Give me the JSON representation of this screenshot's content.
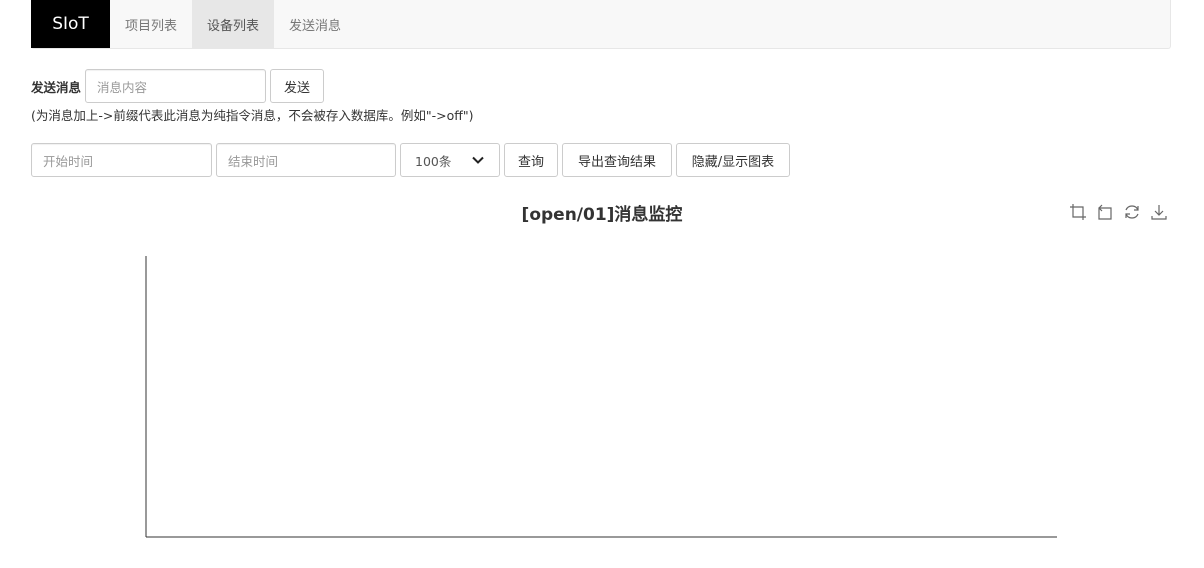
{
  "nav": {
    "brand": "SIoT",
    "items": [
      {
        "label": "项目列表"
      },
      {
        "label": "设备列表"
      },
      {
        "label": "发送消息"
      }
    ]
  },
  "send": {
    "label": "发送消息",
    "placeholder": "消息内容",
    "button": "发送",
    "hint": "(为消息加上->前缀代表此消息为纯指令消息，不会被存入数据库。例如\"->off\")"
  },
  "query": {
    "start_placeholder": "开始时间",
    "end_placeholder": "结束时间",
    "limit_value": "100条",
    "query_button": "查询",
    "export_button": "导出查询结果",
    "toggle_chart_button": "隐藏/显示图表"
  },
  "toolbox": {
    "icons": [
      "zoom-icon",
      "zoom-reset-icon",
      "restore-icon",
      "save-image-icon"
    ]
  },
  "chart_data": {
    "type": "line",
    "title": "[open/01]消息监控",
    "series": [],
    "x": [],
    "xlabel": "",
    "ylabel": "",
    "grid": false
  }
}
